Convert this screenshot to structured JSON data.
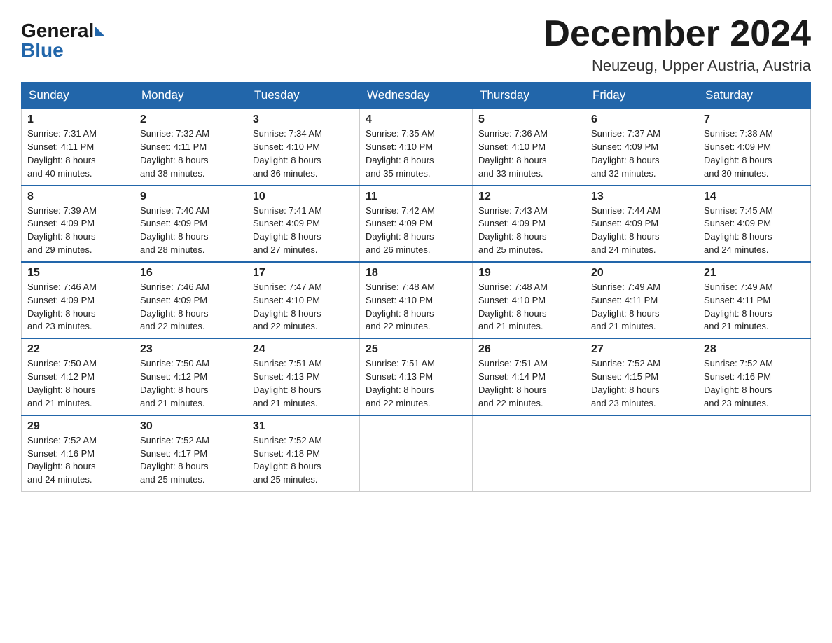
{
  "logo": {
    "general": "General",
    "blue": "Blue"
  },
  "title": "December 2024",
  "location": "Neuzeug, Upper Austria, Austria",
  "days_of_week": [
    "Sunday",
    "Monday",
    "Tuesday",
    "Wednesday",
    "Thursday",
    "Friday",
    "Saturday"
  ],
  "weeks": [
    [
      {
        "day": "1",
        "sunrise": "7:31 AM",
        "sunset": "4:11 PM",
        "daylight": "8 hours and 40 minutes."
      },
      {
        "day": "2",
        "sunrise": "7:32 AM",
        "sunset": "4:11 PM",
        "daylight": "8 hours and 38 minutes."
      },
      {
        "day": "3",
        "sunrise": "7:34 AM",
        "sunset": "4:10 PM",
        "daylight": "8 hours and 36 minutes."
      },
      {
        "day": "4",
        "sunrise": "7:35 AM",
        "sunset": "4:10 PM",
        "daylight": "8 hours and 35 minutes."
      },
      {
        "day": "5",
        "sunrise": "7:36 AM",
        "sunset": "4:10 PM",
        "daylight": "8 hours and 33 minutes."
      },
      {
        "day": "6",
        "sunrise": "7:37 AM",
        "sunset": "4:09 PM",
        "daylight": "8 hours and 32 minutes."
      },
      {
        "day": "7",
        "sunrise": "7:38 AM",
        "sunset": "4:09 PM",
        "daylight": "8 hours and 30 minutes."
      }
    ],
    [
      {
        "day": "8",
        "sunrise": "7:39 AM",
        "sunset": "4:09 PM",
        "daylight": "8 hours and 29 minutes."
      },
      {
        "day": "9",
        "sunrise": "7:40 AM",
        "sunset": "4:09 PM",
        "daylight": "8 hours and 28 minutes."
      },
      {
        "day": "10",
        "sunrise": "7:41 AM",
        "sunset": "4:09 PM",
        "daylight": "8 hours and 27 minutes."
      },
      {
        "day": "11",
        "sunrise": "7:42 AM",
        "sunset": "4:09 PM",
        "daylight": "8 hours and 26 minutes."
      },
      {
        "day": "12",
        "sunrise": "7:43 AM",
        "sunset": "4:09 PM",
        "daylight": "8 hours and 25 minutes."
      },
      {
        "day": "13",
        "sunrise": "7:44 AM",
        "sunset": "4:09 PM",
        "daylight": "8 hours and 24 minutes."
      },
      {
        "day": "14",
        "sunrise": "7:45 AM",
        "sunset": "4:09 PM",
        "daylight": "8 hours and 24 minutes."
      }
    ],
    [
      {
        "day": "15",
        "sunrise": "7:46 AM",
        "sunset": "4:09 PM",
        "daylight": "8 hours and 23 minutes."
      },
      {
        "day": "16",
        "sunrise": "7:46 AM",
        "sunset": "4:09 PM",
        "daylight": "8 hours and 22 minutes."
      },
      {
        "day": "17",
        "sunrise": "7:47 AM",
        "sunset": "4:10 PM",
        "daylight": "8 hours and 22 minutes."
      },
      {
        "day": "18",
        "sunrise": "7:48 AM",
        "sunset": "4:10 PM",
        "daylight": "8 hours and 22 minutes."
      },
      {
        "day": "19",
        "sunrise": "7:48 AM",
        "sunset": "4:10 PM",
        "daylight": "8 hours and 21 minutes."
      },
      {
        "day": "20",
        "sunrise": "7:49 AM",
        "sunset": "4:11 PM",
        "daylight": "8 hours and 21 minutes."
      },
      {
        "day": "21",
        "sunrise": "7:49 AM",
        "sunset": "4:11 PM",
        "daylight": "8 hours and 21 minutes."
      }
    ],
    [
      {
        "day": "22",
        "sunrise": "7:50 AM",
        "sunset": "4:12 PM",
        "daylight": "8 hours and 21 minutes."
      },
      {
        "day": "23",
        "sunrise": "7:50 AM",
        "sunset": "4:12 PM",
        "daylight": "8 hours and 21 minutes."
      },
      {
        "day": "24",
        "sunrise": "7:51 AM",
        "sunset": "4:13 PM",
        "daylight": "8 hours and 21 minutes."
      },
      {
        "day": "25",
        "sunrise": "7:51 AM",
        "sunset": "4:13 PM",
        "daylight": "8 hours and 22 minutes."
      },
      {
        "day": "26",
        "sunrise": "7:51 AM",
        "sunset": "4:14 PM",
        "daylight": "8 hours and 22 minutes."
      },
      {
        "day": "27",
        "sunrise": "7:52 AM",
        "sunset": "4:15 PM",
        "daylight": "8 hours and 23 minutes."
      },
      {
        "day": "28",
        "sunrise": "7:52 AM",
        "sunset": "4:16 PM",
        "daylight": "8 hours and 23 minutes."
      }
    ],
    [
      {
        "day": "29",
        "sunrise": "7:52 AM",
        "sunset": "4:16 PM",
        "daylight": "8 hours and 24 minutes."
      },
      {
        "day": "30",
        "sunrise": "7:52 AM",
        "sunset": "4:17 PM",
        "daylight": "8 hours and 25 minutes."
      },
      {
        "day": "31",
        "sunrise": "7:52 AM",
        "sunset": "4:18 PM",
        "daylight": "8 hours and 25 minutes."
      },
      null,
      null,
      null,
      null
    ]
  ],
  "labels": {
    "sunrise": "Sunrise:",
    "sunset": "Sunset:",
    "daylight": "Daylight:"
  }
}
